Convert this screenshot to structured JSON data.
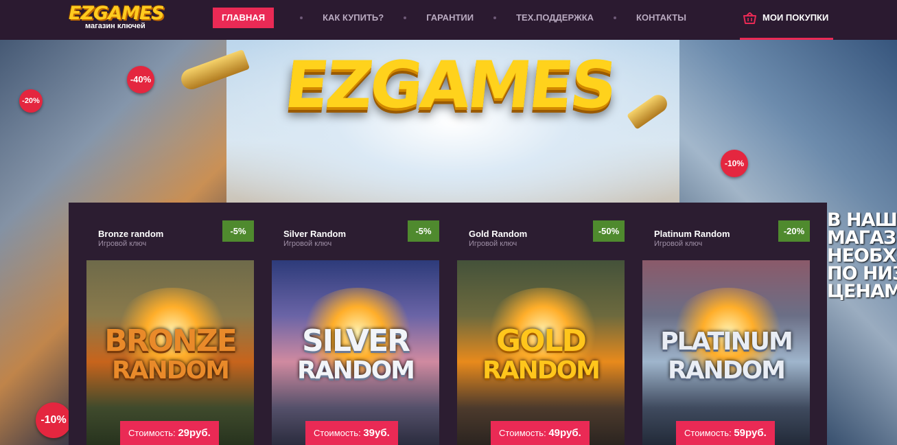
{
  "header": {
    "logo_text": "EZGAMES",
    "logo_sub": "магазин ключей",
    "nav": [
      {
        "label": "ГЛАВНАЯ",
        "active": true
      },
      {
        "label": "КАК КУПИТЬ?",
        "active": false
      },
      {
        "label": "ГАРАНТИИ",
        "active": false
      },
      {
        "label": "ТЕХ.ПОДДЕРЖКА",
        "active": false
      },
      {
        "label": "КОНТАКТЫ",
        "active": false
      }
    ],
    "cart_label": "МОИ ПОКУПКИ",
    "cart_icon": "basket-icon"
  },
  "hero": {
    "title": "EZGAMES",
    "discounts": [
      "-40%",
      "-20%",
      "-10%",
      "-10%"
    ],
    "promo_lines": [
      "В НАШЕМ",
      "МАГАЗИНЕ",
      "НЕОБХОДИМЫЕ",
      "ПО НИЗКИМ",
      "ЦЕНАМ"
    ]
  },
  "products": [
    {
      "title": "Bronze random",
      "subtitle": "Игровой ключ",
      "discount": "-5%",
      "art_line1": "BRONZE",
      "art_line2": "RANDOM",
      "price_label": "Стоимость:",
      "price_value": "29руб."
    },
    {
      "title": "Silver Random",
      "subtitle": "Игровой ключ",
      "discount": "-5%",
      "art_line1": "SILVER",
      "art_line2": "RANDOM",
      "price_label": "Стоимость:",
      "price_value": "39уб."
    },
    {
      "title": "Gold Random",
      "subtitle": "Игровой ключ",
      "discount": "-50%",
      "art_line1": "GOLD",
      "art_line2": "RANDOM",
      "price_label": "Стоимость:",
      "price_value": "49руб."
    },
    {
      "title": "Platinum Random",
      "subtitle": "Игровой ключ",
      "discount": "-20%",
      "art_line1": "PLATINUM",
      "art_line2": "RANDOM",
      "price_label": "Стоимость:",
      "price_value": "59руб."
    }
  ],
  "colors": {
    "header_bg": "#2b1a30",
    "accent": "#ea2a55",
    "badge": "#4f8a2e",
    "panel_bg": "#2c1d31"
  }
}
